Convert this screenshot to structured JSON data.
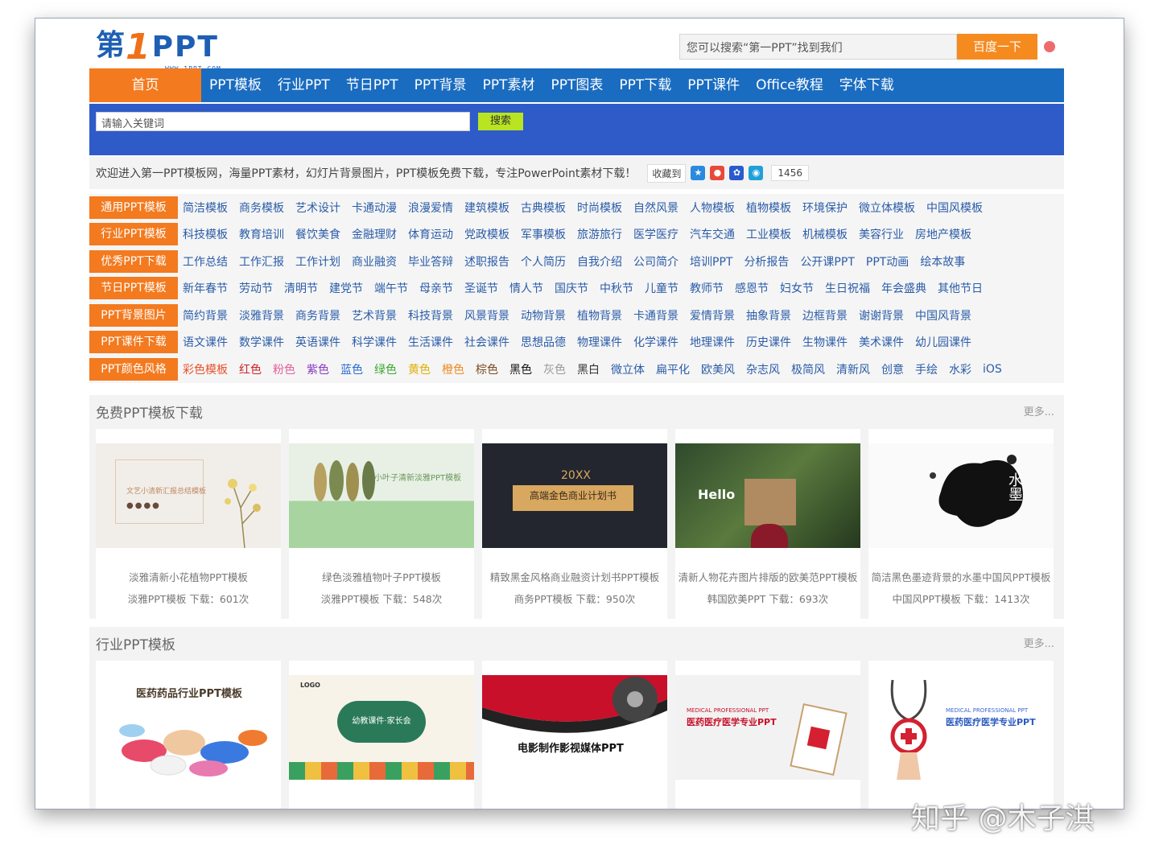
{
  "header": {
    "logo_main": "第",
    "logo_one": "1",
    "logo_ppt": "PPT",
    "logo_url": "WWW.1PPT.COM",
    "search_placeholder": "您可以搜索“第一PPT”找到我们",
    "search_button": "百度一下"
  },
  "nav": {
    "home": "首页",
    "items": [
      "PPT模板",
      "行业PPT",
      "节日PPT",
      "PPT背景",
      "PPT素材",
      "PPT图表",
      "PPT下载",
      "PPT课件",
      "Office教程",
      "字体下载"
    ]
  },
  "subbar": {
    "keyword_placeholder": "请输入关键词",
    "search_button": "搜索"
  },
  "welcome": {
    "text": "欢迎进入第一PPT模板网，海量PPT素材，幻灯片背景图片，PPT模板免费下载，专注PowerPoint素材下载！",
    "fav_label": "收藏到",
    "count": "1456"
  },
  "categories": [
    {
      "head": "通用PPT模板",
      "links": [
        "简洁模板",
        "商务模板",
        "艺术设计",
        "卡通动漫",
        "浪漫爱情",
        "建筑模板",
        "古典模板",
        "时尚模板",
        "自然风景",
        "人物模板",
        "植物模板",
        "环境保护",
        "微立体模板",
        "中国风模板"
      ]
    },
    {
      "head": "行业PPT模板",
      "links": [
        "科技模板",
        "教育培训",
        "餐饮美食",
        "金融理财",
        "体育运动",
        "党政模板",
        "军事模板",
        "旅游旅行",
        "医学医疗",
        "汽车交通",
        "工业模板",
        "机械模板",
        "美容行业",
        "房地产模板"
      ]
    },
    {
      "head": "优秀PPT下载",
      "links": [
        "工作总结",
        "工作汇报",
        "工作计划",
        "商业融资",
        "毕业答辩",
        "述职报告",
        "个人简历",
        "自我介绍",
        "公司简介",
        "培训PPT",
        "分析报告",
        "公开课PPT",
        "PPT动画",
        "绘本故事"
      ]
    },
    {
      "head": "节日PPT模板",
      "links": [
        "新年春节",
        "劳动节",
        "清明节",
        "建党节",
        "端午节",
        "母亲节",
        "圣诞节",
        "情人节",
        "国庆节",
        "中秋节",
        "儿童节",
        "教师节",
        "感恩节",
        "妇女节",
        "生日祝福",
        "年会盛典",
        "其他节日"
      ]
    },
    {
      "head": "PPT背景图片",
      "links": [
        "简约背景",
        "淡雅背景",
        "商务背景",
        "艺术背景",
        "科技背景",
        "风景背景",
        "动物背景",
        "植物背景",
        "卡通背景",
        "爱情背景",
        "抽象背景",
        "边框背景",
        "谢谢背景",
        "中国风背景"
      ]
    },
    {
      "head": "PPT课件下载",
      "links": [
        "语文课件",
        "数学课件",
        "英语课件",
        "科学课件",
        "生活课件",
        "社会课件",
        "思想品德",
        "物理课件",
        "化学课件",
        "地理课件",
        "历史课件",
        "生物课件",
        "美术课件",
        "幼儿园课件"
      ]
    },
    {
      "head": "PPT颜色风格",
      "links": [
        "彩色模板",
        "红色",
        "粉色",
        "紫色",
        "蓝色",
        "绿色",
        "黄色",
        "橙色",
        "棕色",
        "黑色",
        "灰色",
        "黑白",
        "微立体",
        "扁平化",
        "欧美风",
        "杂志风",
        "极简风",
        "清新风",
        "创意",
        "手绘",
        "水彩",
        "iOS"
      ]
    }
  ],
  "color_links": [
    "#e8502a",
    "#d0202a",
    "#e0609a",
    "#8a3ac0",
    "#2a6ad0",
    "#3aa830",
    "#e0b000",
    "#f08a20",
    "#7a4a20",
    "#111111",
    "#999999",
    "#333333"
  ],
  "free_section": {
    "title": "免费PPT模板下载",
    "more": "更多...",
    "cards": [
      {
        "title": "淡雅清新小花植物PPT模板",
        "meta": "淡雅PPT模板  下载：601次",
        "thumb_text": "文艺小清新汇报总结模板"
      },
      {
        "title": "绿色淡雅植物叶子PPT模板",
        "meta": "淡雅PPT模板  下载：548次",
        "thumb_text": "小叶子清新淡雅PPT模板"
      },
      {
        "title": "精致黑金风格商业融资计划书PPT模板",
        "meta": "商务PPT模板  下载：950次",
        "thumb_text": "高端金色商业计划书",
        "thumb_year": "20XX"
      },
      {
        "title": "清新人物花卉图片排版的欧美范PPT模板",
        "meta": "韩国欧美PPT  下载：693次",
        "thumb_text": "Hello"
      },
      {
        "title": "简洁黑色墨迹背景的水墨中国风PPT模板",
        "meta": "中国风PPT模板  下载：1413次",
        "thumb_text": "水墨"
      }
    ]
  },
  "industry_section": {
    "title": "行业PPT模板",
    "more": "更多...",
    "cards": [
      {
        "thumb_text": "医药药品行业PPT模板"
      },
      {
        "thumb_text": "幼教课件·家长会",
        "logo": "LOGO"
      },
      {
        "thumb_text": "电影制作影视媒体PPT"
      },
      {
        "thumb_text": "医药医疗医学专业PPT",
        "caption": "MEDICAL PROFESSIONAL PPT"
      },
      {
        "thumb_text": "医药医疗医学专业PPT",
        "caption": "MEDICAL PROFESSIONAL PPT"
      }
    ]
  },
  "watermark": "知乎 @木子淇"
}
